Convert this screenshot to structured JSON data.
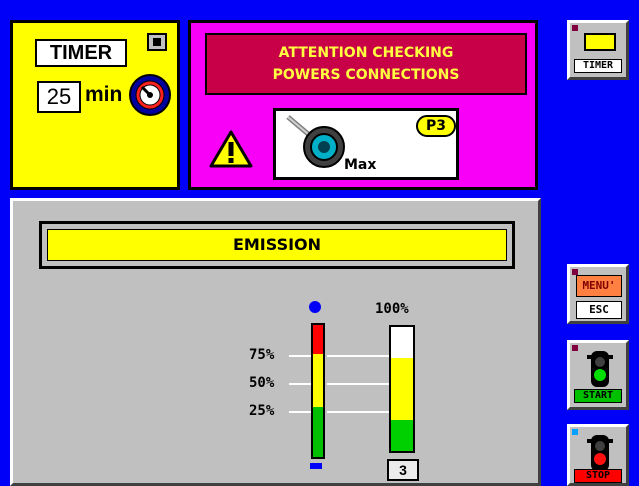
{
  "timer": {
    "title": "TIMER",
    "value": "25",
    "unit": "min"
  },
  "alert": {
    "line1": "ATTENTION CHECKING",
    "line2": "POWERS CONNECTIONS",
    "probe_label": "Max",
    "program_badge": "P3"
  },
  "side_buttons": {
    "timer_label": "TIMER",
    "menu_label": "MENU'",
    "esc_label": "ESC",
    "start_label": "START",
    "stop_label": "STOP"
  },
  "emission": {
    "title": "EMISSION",
    "max_label": "100%",
    "tick_labels": [
      "75%",
      "50%",
      "25%"
    ],
    "power_level": "3",
    "power_fraction": 0.75,
    "green_fraction": 0.25
  },
  "colors": {
    "background": "#0000f8",
    "panel_yellow": "#ffff00",
    "panel_magenta": "#f800f8",
    "alert_red": "#c80048",
    "alert_text": "#ffff40",
    "start_green": "#00c000",
    "stop_red": "#ff0000"
  },
  "icons": {
    "warning": "warning-triangle-icon",
    "knob": "timer-knob-icon",
    "probe": "probe-handpiece-icon",
    "traffic_light": "traffic-light-icon"
  }
}
